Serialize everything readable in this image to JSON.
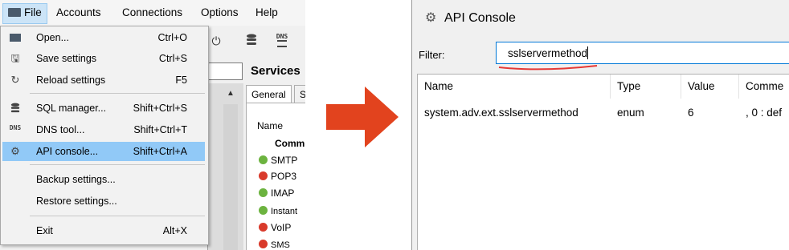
{
  "left_app": {
    "menubar": [
      "File",
      "Accounts",
      "Connections",
      "Options",
      "Help"
    ],
    "file_menu": [
      {
        "icon": "folder-open-icon",
        "label": "Open...",
        "shortcut": "Ctrl+O"
      },
      {
        "icon": "save-icon",
        "label": "Save settings",
        "shortcut": "Ctrl+S"
      },
      {
        "icon": "reload-icon",
        "label": "Reload settings",
        "shortcut": "F5"
      },
      {
        "icon": "database-icon",
        "label": "SQL manager...",
        "shortcut": "Shift+Ctrl+S"
      },
      {
        "icon": "dns-icon",
        "label": "DNS tool...",
        "shortcut": "Shift+Ctrl+T"
      },
      {
        "icon": "gear-icon",
        "label": "API console...",
        "shortcut": "Shift+Ctrl+A",
        "highlighted": true
      },
      {
        "icon": "",
        "label": "Backup settings...",
        "shortcut": ""
      },
      {
        "icon": "",
        "label": "Restore settings...",
        "shortcut": ""
      },
      {
        "icon": "",
        "label": "Exit",
        "shortcut": "Alt+X"
      }
    ],
    "services_title": "Services",
    "tabs": [
      "General",
      "S"
    ],
    "services_header": "Name",
    "services_group": "Comm",
    "services": [
      {
        "label": "SMTP",
        "status": "green"
      },
      {
        "label": "POP3",
        "status": "red"
      },
      {
        "label": "IMAP",
        "status": "green"
      },
      {
        "label": "Instant",
        "status": "green"
      },
      {
        "label": "VoIP",
        "status": "red"
      },
      {
        "label": "SMS",
        "status": "red"
      }
    ],
    "toolbar_dns_label": "DNS"
  },
  "api_console": {
    "title": "API Console",
    "filter_label": "Filter:",
    "filter_value": "sslservermethod",
    "columns": [
      "Name",
      "Type",
      "Value",
      "Comme"
    ],
    "rows": [
      {
        "name": "system.adv.ext.sslservermethod",
        "type": "enum",
        "value": "6",
        "comment": ", 0 : def"
      }
    ]
  },
  "colors": {
    "highlight": "#91c9f7",
    "arrow": "#e2431e",
    "status_green": "#6cb33f",
    "status_red": "#d93a2b",
    "underline": "#e53935"
  }
}
